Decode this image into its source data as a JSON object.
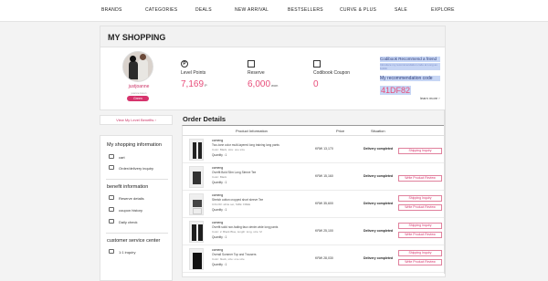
{
  "nav": [
    "BRANDS",
    "CATEGORIES",
    "DEALS",
    "NEW ARRIVAL",
    "BESTSELLERS",
    "CURVE & PLUS",
    "SALE",
    "EXPLORE"
  ],
  "page_title": "MY SHOPPING",
  "user": {
    "name": "justjoanne",
    "sub": "joanne.kwon",
    "grade": "Green"
  },
  "stats": {
    "level_points": {
      "label": "Level Points",
      "value": "7,169",
      "unit": "P"
    },
    "reserve": {
      "label": "Reserve",
      "value": "6,000",
      "unit": "won"
    },
    "coupon": {
      "label": "Codibook Coupon",
      "value": "0"
    }
  },
  "recommend": {
    "title": "Codibook Recommend a friend",
    "desc": "Introduce my recommendation code at Long as 6,000",
    "code_label": "My recommendation code",
    "code": "41DF82",
    "more": "learn more ›"
  },
  "sidebar": {
    "level_benefits": "View My Level Benefits ›",
    "sections": [
      {
        "title": "My shopping information",
        "items": [
          "cart",
          "Order/delivery inquiry"
        ]
      },
      {
        "title": "benefit information",
        "items": [
          "Reserve details",
          "coupon history",
          "Daily check"
        ]
      },
      {
        "title": "customer service center",
        "items": [
          "1:1 inquiry"
        ]
      }
    ]
  },
  "orders": {
    "title": "Order Details",
    "headers": {
      "product": "Product Information",
      "price": "Price",
      "situation": "Situation"
    },
    "rows": [
      {
        "brand": "ccmeng",
        "name": "Two-tone color multi-layered long training long pants",
        "option": "Color: Black, size: one size",
        "qty": "Quantity : 1",
        "price": "KRW 13,170",
        "status": "Delivery completed",
        "button": "Shipping Inquiry"
      },
      {
        "brand": "ccmeng",
        "name": "Overfit Bold Slim Long Sleeve Tee",
        "option": "Color: Black",
        "qty": "Quantity : 1",
        "price": "KRW 15,160",
        "status": "Delivery completed",
        "button": "Write Product Review"
      },
      {
        "brand": "ccmeng",
        "name": "Stretch cotton cropped short sleeve Tee",
        "option": "COLOR: white set, SIZE: FREE",
        "qty": "Quantity : 1",
        "price": "KRW 35,600",
        "status": "Delivery completed",
        "button": "Shipping Inquiry"
      },
      {
        "brand": "ccmeng",
        "name": "Overfit solid non-fading faux denim wide long pants",
        "option": "Color: 2. Black Blue, length: long, size: M",
        "qty": "Quantity : 1",
        "price": "KRW 25,100",
        "status": "Delivery completed",
        "button": "Shipping Inquiry"
      },
      {
        "brand": "ccmeng",
        "name": "Overall Summer Top and Trousers",
        "option": "Color: black, size: one size",
        "qty": "Quantity : 1",
        "price": "KRW 28,030",
        "status": "Delivery completed",
        "button": "Write Product Review"
      }
    ]
  }
}
